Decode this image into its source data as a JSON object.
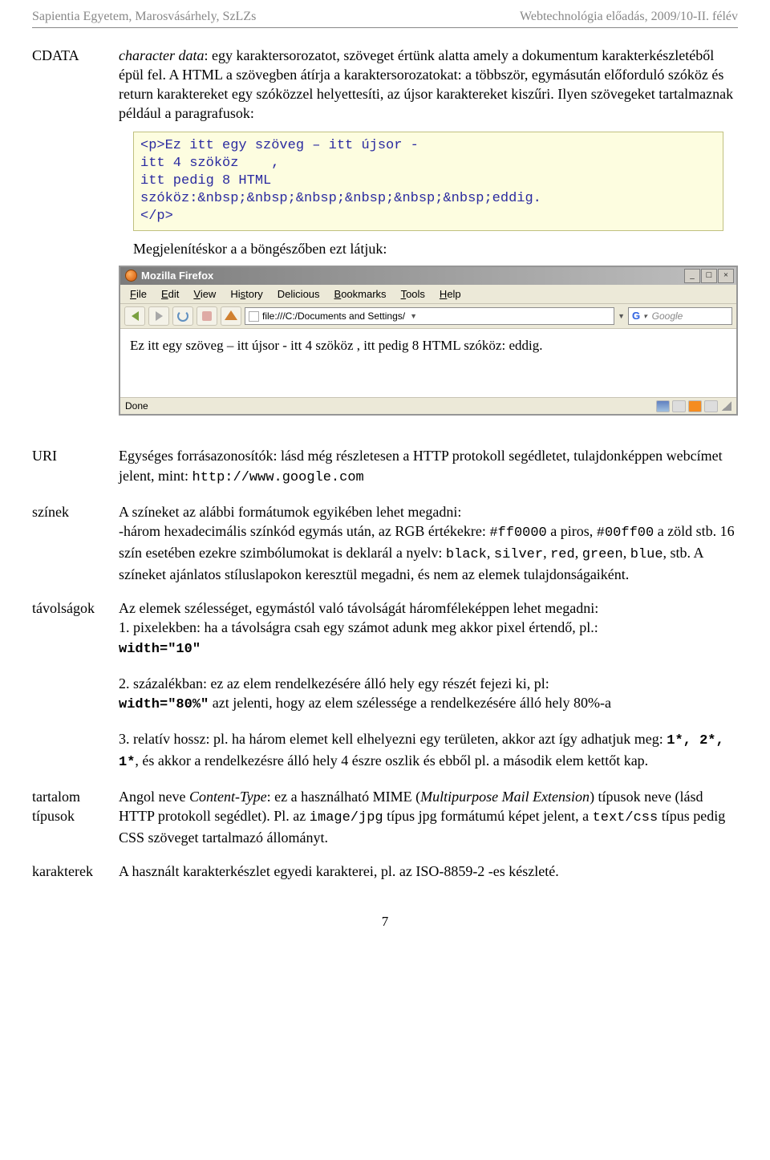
{
  "header": {
    "left": "Sapientia Egyetem, Marosvásárhely, SzLZs",
    "right": "Webtechnológia előadás, 2009/10-II. félév"
  },
  "cdata": {
    "term": "CDATA",
    "para1_a": "character data",
    "para1_b": ": egy karaktersorozatot, szöveget értünk alatta amely a dokumentum karakterkészletéből épül fel. A HTML a szövegben átírja a karaktersorozatokat: a többször, egymásután előforduló szóköz és return karaktereket egy szóközzel helyettesíti, az újsor karaktereket kiszűri. Ilyen szövegeket tartalmaznak például a paragrafusok:",
    "code": "<p>Ez itt egy szöveg – itt újsor -\nitt 4 szököz    ,\nitt pedig 8 HTML\nszóköz:&nbsp;&nbsp;&nbsp;&nbsp;&nbsp;&nbsp;eddig.\n</p>",
    "subtext": "Megjelenítéskor a a böngészőben ezt látjuk:"
  },
  "ff": {
    "title": "Mozilla Firefox",
    "menus": [
      {
        "u": "F",
        "rest": "ile"
      },
      {
        "u": "E",
        "rest": "dit"
      },
      {
        "u": "V",
        "rest": "iew"
      },
      {
        "pre": "Hi",
        "u": "s",
        "rest": "tory"
      },
      {
        "u": "",
        "rest": "Delicious"
      },
      {
        "u": "B",
        "rest": "ookmarks"
      },
      {
        "u": "T",
        "rest": "ools"
      },
      {
        "u": "H",
        "rest": "elp"
      }
    ],
    "url": "file:///C:/Documents and Settings/",
    "search_placeholder": "Google",
    "content": "Ez itt egy szöveg – itt újsor - itt 4 szököz , itt pedig 8 HTML szóköz:       eddig.",
    "status": "Done"
  },
  "uri": {
    "term": "URI",
    "text_a": "Egységes forrásazonosítók: lásd még részletesen a HTTP protokoll segédletet, tulajdonképpen webcímet jelent, mint: ",
    "code": "http://www.google.com"
  },
  "szinek": {
    "term": "színek",
    "t1": "A színeket az alábbi formátumok egyikében lehet megadni:",
    "t2a": "-három hexadecimális színkód egymás után, az RGB értékekre: ",
    "c1": "#ff0000",
    "t2b": " a piros, ",
    "c2": "#00ff00",
    "t2c": " a zöld stb. 16 szín esetében ezekre szimbólumokat is deklarál a nyelv: ",
    "c3": "black",
    "c4": "silver",
    "c5": "red",
    "c6": "green",
    "c7": "blue",
    "t2d": ", stb. A színeket ajánlatos stíluslapokon keresztül megadni, és nem az elemek tulajdonságaiként."
  },
  "tav": {
    "term": "távolságok",
    "p1": "Az elemek szélességet, egymástól való távolságát háromféleképpen lehet megadni:",
    "li1a": "1. pixelekben:  ha a távolságra csah egy számot adunk meg akkor pixel értendő, pl.: ",
    "li1c": "width=\"10\"",
    "li2a": "2. százalékban: ez az elem rendelkezésére álló hely egy részét fejezi ki, pl: ",
    "li2c": "width=\"80%\"",
    "li2b": " azt jelenti, hogy az elem szélessége a rendelkezésére álló  hely 80%-a",
    "li3a": "3. relatív hossz: pl. ha három elemet kell elhelyezni egy területen, akkor azt így adhatjuk meg: ",
    "li3c": "1*, 2*, 1*",
    "li3b": ", és akkor a rendelkezésre álló hely 4 észre oszlik és ebből pl. a második elem kettőt kap."
  },
  "tart": {
    "term": "tartalom típusok",
    "t1a": "Angol neve ",
    "t1i": "Content-Type",
    "t1b": ": ez a használható MIME (",
    "t1i2": "Multipurpose Mail Extension",
    "t1c": ") típusok neve (lásd HTTP protokoll segédlet). Pl. az ",
    "c1": "image/jpg",
    "t1d": " típus jpg formátumú képet jelent, a ",
    "c2": "text/css",
    "t1e": " típus pedig CSS szöveget tartalmazó állományt."
  },
  "kar": {
    "term": "karakterek",
    "t": "A használt karakterkészlet egyedi karakterei, pl. az ISO-8859-2 -es készleté."
  },
  "pagenum": "7"
}
